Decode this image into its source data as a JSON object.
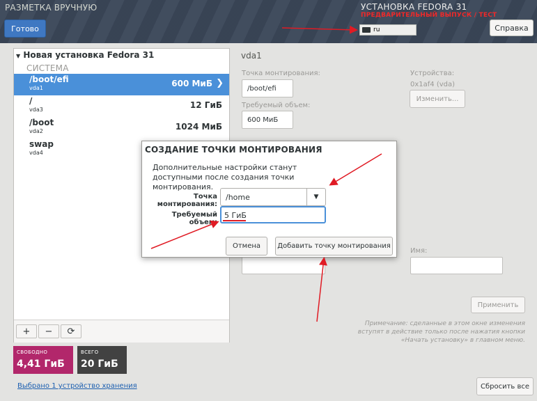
{
  "header": {
    "title": "РАЗМЕТКА ВРУЧНУЮ",
    "done_label": "Готово",
    "install_title": "УСТАНОВКА FEDORA 31",
    "prerelease": "ПРЕДВАРИТЕЛЬНЫЙ ВЫПУСК / ТЕСТ",
    "keyboard_layout": "ru",
    "help_label": "Справка"
  },
  "left_panel": {
    "tree_title": "Новая установка Fedora 31",
    "group_label": "СИСТЕМА",
    "mount_points": [
      {
        "name": "/boot/efi",
        "device": "vda1",
        "size": "600 МиБ",
        "selected": true
      },
      {
        "name": "/",
        "device": "vda3",
        "size": "12 ГиБ",
        "selected": false
      },
      {
        "name": "/boot",
        "device": "vda2",
        "size": "1024 МиБ",
        "selected": false
      },
      {
        "name": "swap",
        "device": "vda4",
        "size": "",
        "selected": false
      }
    ],
    "tools": {
      "add": "+",
      "remove": "−",
      "refresh": "⟳"
    },
    "free": {
      "label": "СВОБОДНО",
      "value": "4,41 ГиБ"
    },
    "total": {
      "label": "ВСЕГО",
      "value": "20 ГиБ"
    },
    "storage_link": "Выбрано 1 устройство хранения"
  },
  "right_pane": {
    "device_title": "vda1",
    "mount_label": "Точка монтирования:",
    "mount_value": "/boot/efi",
    "capacity_label": "Требуемый объем:",
    "capacity_value": "600 МиБ",
    "devices_label": "Устройства:",
    "devices_value": "0x1af4 (vda)",
    "change_label": "Изменить...",
    "name_label": "Имя:",
    "apply_label": "Применить",
    "note": "Примечание:  сделанные в этом окне изменения вступят в действие только после нажатия кнопки «Начать установку» в главном меню.",
    "reset_label": "Сбросить все"
  },
  "dialog": {
    "title": "СОЗДАНИЕ ТОЧКИ МОНТИРОВАНИЯ",
    "description": "Дополнительные настройки станут доступными после создания точки монтирования.",
    "mount_label": "Точка монтирования:",
    "mount_value": "/home",
    "capacity_label": "Требуемый объем:",
    "capacity_value": "5 ГиБ",
    "cancel_label": "Отмена",
    "add_label": "Добавить точку монтирования"
  },
  "colors": {
    "accent": "#4a90d9",
    "free_box": "#b2276b",
    "total_box": "#424242",
    "annotation": "#e01b24"
  }
}
